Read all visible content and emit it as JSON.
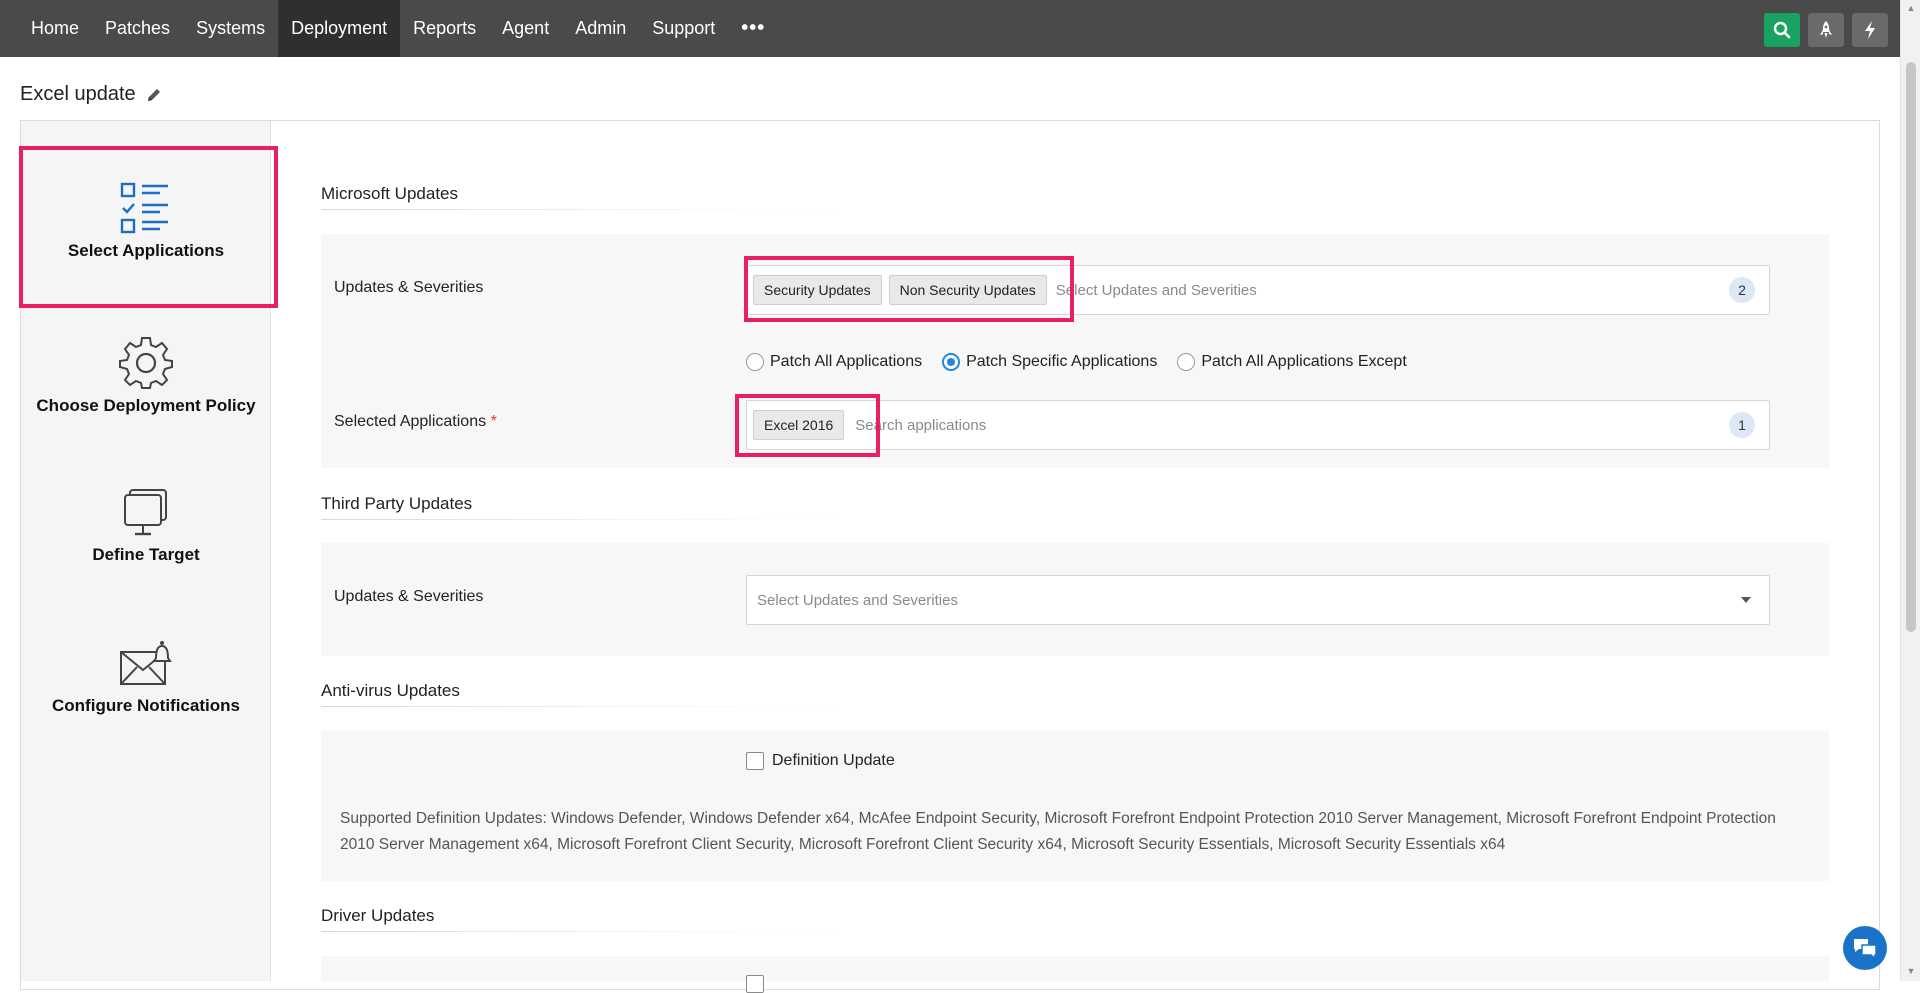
{
  "nav": {
    "items": [
      {
        "label": "Home",
        "active": false
      },
      {
        "label": "Patches",
        "active": false
      },
      {
        "label": "Systems",
        "active": false
      },
      {
        "label": "Deployment",
        "active": true
      },
      {
        "label": "Reports",
        "active": false
      },
      {
        "label": "Agent",
        "active": false
      },
      {
        "label": "Admin",
        "active": false
      },
      {
        "label": "Support",
        "active": false
      }
    ],
    "more_label": "•••",
    "icons": [
      "search-icon",
      "rocket-icon",
      "lightning-icon"
    ]
  },
  "page": {
    "title": "Excel update"
  },
  "steps": [
    {
      "label": "Select Applications",
      "icon": "checklist-icon",
      "active": true
    },
    {
      "label": "Choose Deployment Policy",
      "icon": "gear-icon",
      "active": false
    },
    {
      "label": "Define Target",
      "icon": "monitor-icon",
      "active": false
    },
    {
      "label": "Configure Notifications",
      "icon": "envelope-bell-icon",
      "active": false
    }
  ],
  "microsoft": {
    "title": "Microsoft Updates",
    "updates_label": "Updates & Severities",
    "chips": [
      "Security Updates",
      "Non Security Updates"
    ],
    "updates_placeholder": "Select Updates and Severities",
    "updates_count": "2",
    "radio_options": [
      {
        "label": "Patch All Applications",
        "selected": false
      },
      {
        "label": "Patch Specific Applications",
        "selected": true
      },
      {
        "label": "Patch All Applications Except",
        "selected": false
      }
    ],
    "apps_label": "Selected Applications",
    "apps_required_mark": "*",
    "app_chips": [
      "Excel 2016"
    ],
    "apps_placeholder": "Search applications",
    "apps_count": "1"
  },
  "third_party": {
    "title": "Third Party Updates",
    "updates_label": "Updates & Severities",
    "updates_placeholder": "Select Updates and Severities"
  },
  "antivirus": {
    "title": "Anti-virus Updates",
    "checkbox_label": "Definition Update",
    "note": "Supported Definition Updates: Windows Defender, Windows Defender x64, McAfee Endpoint Security, Microsoft Forefront Endpoint Protection 2010 Server Management, Microsoft Forefront Endpoint Protection 2010 Server Management x64, Microsoft Forefront Client Security, Microsoft Forefront Client Security x64, Microsoft Security Essentials, Microsoft Security Essentials x64"
  },
  "driver": {
    "title": "Driver Updates"
  },
  "colors": {
    "highlight": "#e91e63",
    "accent": "#1e88e5",
    "nav_bg": "#4a4a4a",
    "search_btn": "#1aa260"
  }
}
